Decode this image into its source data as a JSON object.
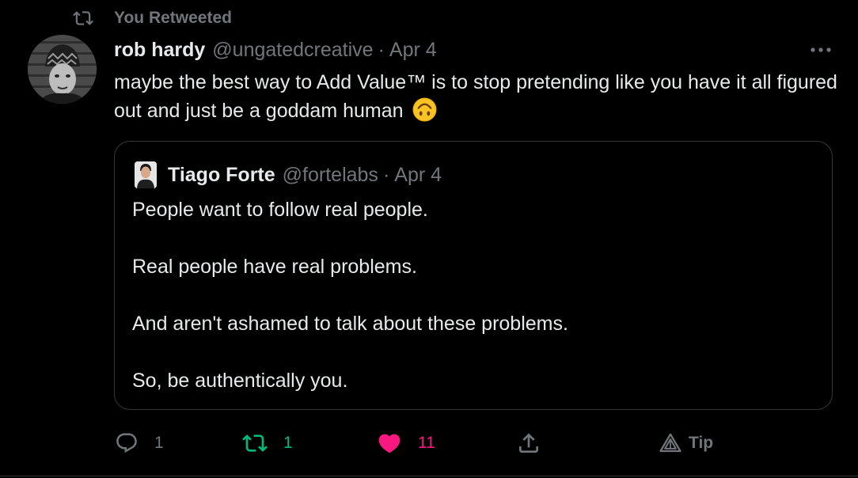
{
  "context": {
    "label": "You Retweeted"
  },
  "author": {
    "display_name": "rob hardy",
    "handle": "@ungatedcreative",
    "separator": "·",
    "date": "Apr 4"
  },
  "tweet": {
    "text": "maybe the best way to Add Value™ is to stop pretending like you have it all figured out and just be a goddam human",
    "emoji": "upside-down-face"
  },
  "quoted": {
    "display_name": "Tiago Forte",
    "handle": "@fortelabs",
    "separator": "·",
    "date": "Apr 4",
    "paragraphs": [
      "People want to follow real people.",
      "Real people have real problems.",
      "And aren't ashamed to talk about these problems.",
      "So, be authentically you."
    ]
  },
  "actions": {
    "reply_count": "1",
    "retweet_count": "1",
    "like_count": "11",
    "tip_label": "Tip"
  },
  "colors": {
    "background": "#000000",
    "text": "#e7e9ea",
    "secondary": "#71767b",
    "retweet_green": "#00ba7c",
    "like_pink": "#f91880",
    "border": "#333639"
  },
  "icons": {
    "context": "retweet-icon",
    "more": "more-icon",
    "reply": "reply-icon",
    "retweet": "retweet-icon",
    "like": "heart-icon",
    "share": "share-icon",
    "tip": "tip-icon"
  }
}
